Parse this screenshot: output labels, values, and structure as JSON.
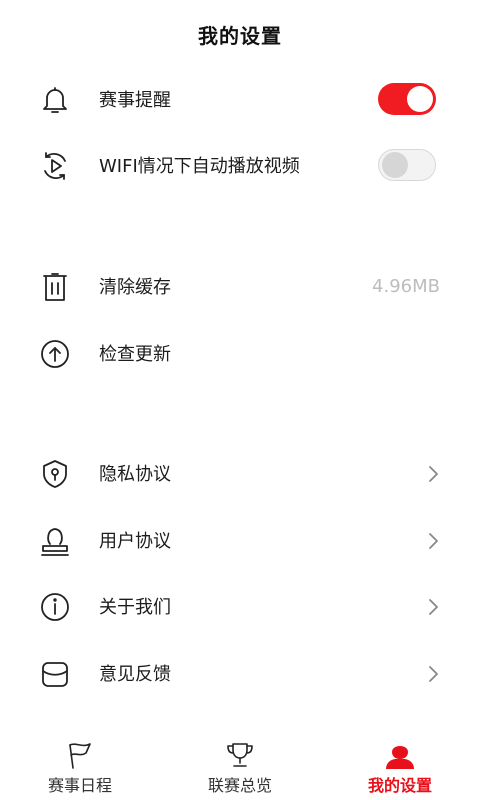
{
  "header": {
    "title": "我的设置"
  },
  "toggles": [
    {
      "label": "赛事提醒",
      "icon": "bell-icon",
      "state": "on"
    },
    {
      "label": "WIFI情况下自动播放视频",
      "icon": "play-circle-icon",
      "state": "off"
    }
  ],
  "storage": [
    {
      "label": "清除缓存",
      "icon": "trash-icon",
      "value": "4.96MB"
    },
    {
      "label": "检查更新",
      "icon": "arrow-up-circle-icon"
    }
  ],
  "links": [
    {
      "label": "隐私协议",
      "icon": "shield-icon"
    },
    {
      "label": "用户协议",
      "icon": "stamp-icon"
    },
    {
      "label": "关于我们",
      "icon": "info-icon"
    },
    {
      "label": "意见反馈",
      "icon": "feedback-box-icon"
    }
  ],
  "tabbar": {
    "items": [
      {
        "label": "赛事日程",
        "icon": "flag-icon",
        "active": false
      },
      {
        "label": "联赛总览",
        "icon": "trophy-icon",
        "active": false
      },
      {
        "label": "我的设置",
        "icon": "user-icon",
        "active": true
      }
    ]
  },
  "colors": {
    "accent": "#f01c21",
    "active_tab": "#e8101a",
    "value_text": "#bdbdbd"
  }
}
